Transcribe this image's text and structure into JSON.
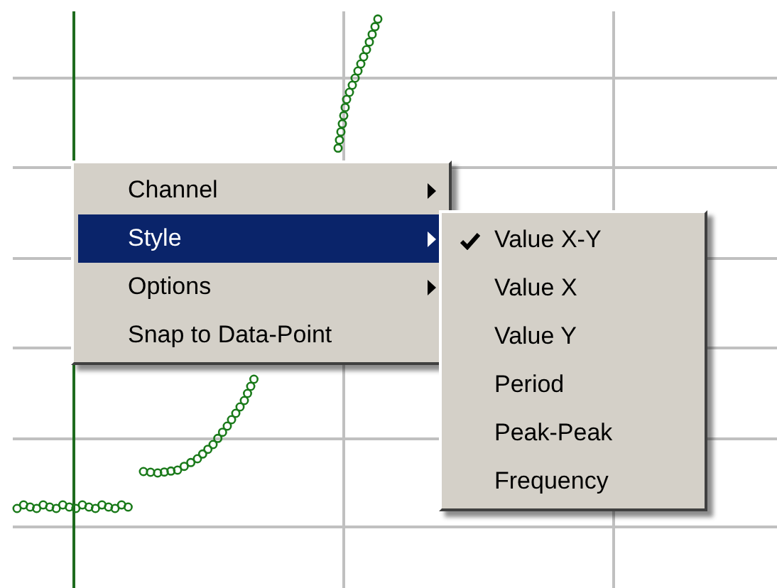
{
  "context_menu": {
    "items": [
      {
        "label": "Channel",
        "submenu": true,
        "selected": false
      },
      {
        "label": "Style",
        "submenu": true,
        "selected": true
      },
      {
        "label": "Options",
        "submenu": true,
        "selected": false
      },
      {
        "label": "Snap to Data-Point",
        "submenu": false,
        "selected": false
      }
    ]
  },
  "style_submenu": {
    "items": [
      {
        "label": "Value X-Y",
        "checked": true
      },
      {
        "label": "Value X",
        "checked": false
      },
      {
        "label": "Value Y",
        "checked": false
      },
      {
        "label": "Period",
        "checked": false
      },
      {
        "label": "Peak-Peak",
        "checked": false
      },
      {
        "label": "Frequency",
        "checked": false
      }
    ]
  }
}
